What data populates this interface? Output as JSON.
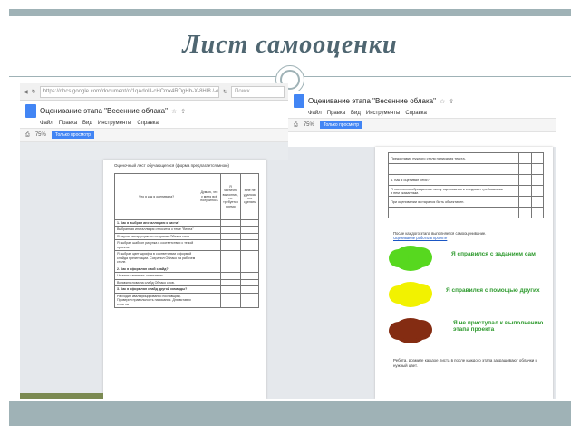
{
  "slide": {
    "title": "Лист самооценки",
    "accent_color": "#9fb2b6",
    "title_color": "#4f6671"
  },
  "left": {
    "browser": {
      "url": "https://docs.google.com/document/d/1qAdoU-cHCmx4RDgHb-X-8HI8 /-edit&SED",
      "search_placeholder": "Поиск"
    },
    "doc": {
      "title": "Оценивание этапа \"Весенние облака\"",
      "menu": [
        "Файл",
        "Правка",
        "Вид",
        "Инструменты",
        "Справка"
      ],
      "zoom": "75%",
      "mode": "Только просмотр"
    },
    "sheet": {
      "heading": "Оценочный лист обучающегося (форма предлагается мною)",
      "header": [
        "Что я как я оценивала?",
        "Думаю, что у меня всё получилось",
        "Я частично выполнил, но требуется время",
        "Мне не удалось это сделать"
      ],
      "rows": [
        {
          "text": "1. Как я выбрал инсталляцию к кисти?",
          "kind": "q"
        },
        {
          "text": "Выбранная инсталляция относится к теме \"Весна\"",
          "kind": "r"
        },
        {
          "text": "Я изучил инструкцию по созданию Облака слов.",
          "kind": "r"
        },
        {
          "text": "Я выбрал шаблон рисунка в соответствии с темой проекта.",
          "kind": "r"
        },
        {
          "text": "Я выбрал цвет шрифта в соответствии с формой слайда презентации. Сохранил Облако на рабочем столе.",
          "kind": "r"
        },
        {
          "text": "2. Как я оформлял свой слайд?",
          "kind": "q"
        },
        {
          "text": "Написал название номинации.",
          "kind": "r"
        },
        {
          "text": "Вставил слова на слайд Облако слов.",
          "kind": "r"
        },
        {
          "text": "3. Как я оформлял слайд другой команды?",
          "kind": "q"
        },
        {
          "text": "Расходил квалифицированно поставщику. Проверил правильность написания. Для вставки слов на",
          "kind": "r"
        }
      ]
    }
  },
  "right": {
    "doc": {
      "title": "Оценивание этапа \"Весенние облака\"",
      "menu": [
        "Файл",
        "Правка",
        "Вид",
        "Инструменты",
        "Справка"
      ],
      "zoom": "75%",
      "mode": "Только просмотр"
    },
    "sheet": {
      "rows": [
        "Предоставил нужного стиля написания текста.",
        "",
        "4. Как я оценивал себя?",
        "Я постоянно обращался к листу оценивания и следовал требованиям в нем указанным.",
        "При оценивании я старался быть объективен.",
        ""
      ]
    },
    "legend": {
      "intro": "После каждого этапа выполняется самооценивание.",
      "link": "Оценивание работы в проекте",
      "items": [
        {
          "color": "#57d81f",
          "label": "Я справился с заданием сам"
        },
        {
          "color": "#f2f200",
          "label": "Я справился с помощью других"
        },
        {
          "color": "#842c12",
          "label": "Я не приступал к выполнению этапа проекта"
        }
      ],
      "closing": "Ребята, розмите каждое листа в после каждого этапа закрашивают облачки в нужный цвет."
    }
  }
}
